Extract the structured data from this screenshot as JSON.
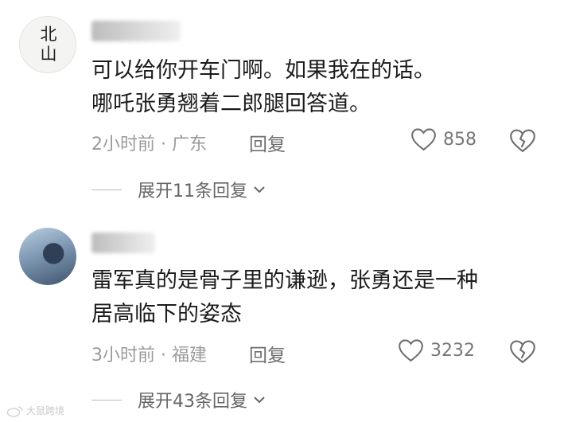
{
  "comments": [
    {
      "avatar_text": [
        "北",
        "山"
      ],
      "text_lines": [
        "可以给你开车门啊。如果我在的话。",
        "哪吒张勇翘着二郎腿回答道。"
      ],
      "meta": "2小时前 · 广东",
      "reply_label": "回复",
      "likes": "858",
      "expand_label": "展开11条回复"
    },
    {
      "text_lines": [
        "雷军真的是骨子里的谦逊，张勇还是一种",
        "居高临下的姿态"
      ],
      "meta": "3小时前 · 福建",
      "reply_label": "回复",
      "likes": "3232",
      "expand_label": "展开43条回复"
    }
  ],
  "watermark": "大鼠跨境",
  "colors": {
    "text": "#1b1b1b",
    "meta": "#9a9a9a",
    "icon": "#6e6e6e"
  },
  "icons": {
    "like": "heart-outline-icon",
    "dislike": "broken-heart-icon",
    "expand": "chevron-down-icon"
  }
}
